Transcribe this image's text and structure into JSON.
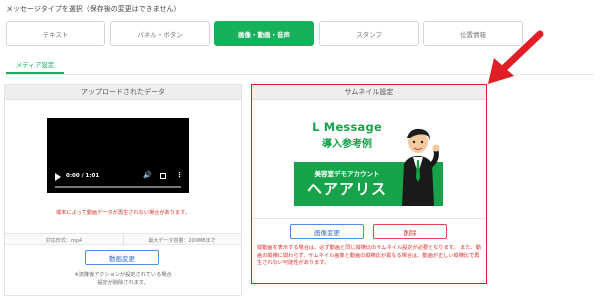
{
  "instruction": "メッセージタイプを選択（保存後の変更はできません）",
  "message_types": [
    {
      "label": "テキスト",
      "active": false
    },
    {
      "label": "パネル・ボタン",
      "active": false
    },
    {
      "label": "画像・動画・音声",
      "active": true
    },
    {
      "label": "スタンプ",
      "active": false
    },
    {
      "label": "位置情報",
      "active": false
    }
  ],
  "sub_tab": "メディア設定",
  "upload_panel": {
    "title": "アップロードされたデータ",
    "video_time": "0:00 / 1:01",
    "warning": "端末によって動画データが再生されない場合があります。",
    "format_label": "対応形式：mp4",
    "max_size_label": "最大データ容量：200MBまで",
    "change_button": "動画変更",
    "note_line1": "※流降後アクションが設定されている場合",
    "note_line2": "設定が削除されます。"
  },
  "thumbnail_panel": {
    "title": "サムネイル設定",
    "image": {
      "title": "L Message",
      "subtitle": "導入参考例",
      "band_small": "美容室デモアカウント",
      "band_big": "ヘアアリス"
    },
    "change_button": "画像変更",
    "delete_button": "削除",
    "note": "縦動画を表示する場合は、必ず動画と同じ縦横比のサムネイル設定が必要となります。 また、動画の縦横に関わらず、サムネイル画像と動画の縦横比が異なる場合は、動画が正しい縦横比で再生されない可能性があります。"
  },
  "colors": {
    "accent_green": "#16b15a",
    "highlight_red": "#e11d25",
    "link_blue": "#2f6fc9"
  }
}
